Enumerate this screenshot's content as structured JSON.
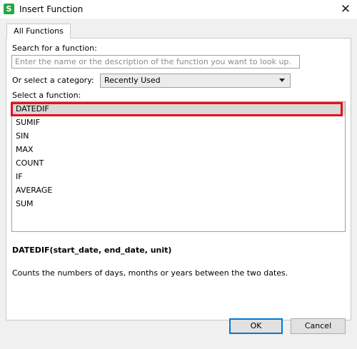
{
  "window": {
    "title": "Insert Function",
    "icon_letter": "S",
    "close_glyph": "✕"
  },
  "tabs": [
    {
      "label": "All Functions",
      "active": true
    }
  ],
  "search": {
    "label": "Search for a function:",
    "placeholder": "Enter the name or the description of the function you want to look up.",
    "value": ""
  },
  "category": {
    "label": "Or select a category:",
    "selected": "Recently Used"
  },
  "functions": {
    "label": "Select a function:",
    "items": [
      "DATEDIF",
      "SUMIF",
      "SIN",
      "MAX",
      "COUNT",
      "IF",
      "AVERAGE",
      "SUM"
    ],
    "selected": "DATEDIF"
  },
  "details": {
    "signature": "DATEDIF(start_date, end_date, unit)",
    "description": "Counts the numbers of days, months or years between the two dates."
  },
  "buttons": {
    "ok": "OK",
    "cancel": "Cancel"
  },
  "colors": {
    "highlight": "#e0131d",
    "app_icon": "#27a745",
    "focus": "#0078d7"
  }
}
